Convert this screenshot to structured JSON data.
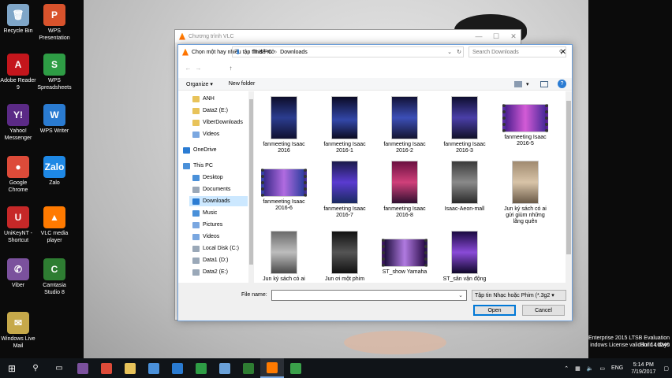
{
  "desktop": {
    "icons": [
      {
        "label": "Recycle Bin",
        "color": "#7fa6c8",
        "glyph": "🗑"
      },
      {
        "label": "WPS Presentation",
        "color": "#d9532c",
        "glyph": "P"
      },
      {
        "label": "Adobe Reader 9",
        "color": "#c4161c",
        "glyph": "A"
      },
      {
        "label": "WPS Spreadsheets",
        "color": "#2e9d45",
        "glyph": "S"
      },
      {
        "label": "Yahoo! Messenger",
        "color": "#5b2a86",
        "glyph": "Y!"
      },
      {
        "label": "WPS Writer",
        "color": "#2a7bd1",
        "glyph": "W"
      },
      {
        "label": "Google Chrome",
        "color": "#dd4b39",
        "glyph": "●"
      },
      {
        "label": "Zalo",
        "color": "#1e88e5",
        "glyph": "Zalo"
      },
      {
        "label": "UniKeyNT - Shortcut",
        "color": "#c62828",
        "glyph": "U"
      },
      {
        "label": "VLC media player",
        "color": "#ff7a00",
        "glyph": "▲"
      },
      {
        "label": "Viber",
        "color": "#7b519d",
        "glyph": "✆"
      },
      {
        "label": "Camtasia Studio 8",
        "color": "#2e7d32",
        "glyph": "C"
      },
      {
        "label": "Windows Live Mail",
        "color": "#c6a94a",
        "glyph": "✉"
      }
    ],
    "watermark_line1": "Enterprise 2015 LTSB Evaluation",
    "watermark_line2": "indows License valid for 14 days",
    "watermark_line3": "Build 10240"
  },
  "vlc_window": {
    "title": "Chương trình VLC"
  },
  "dialog": {
    "title": "Chọn một hay nhiều tập tin để mở",
    "close_glyph": "✕",
    "nav": {
      "back": "←",
      "forward": "→",
      "up": "↑"
    },
    "address": [
      "This PC",
      "Downloads"
    ],
    "search_placeholder": "Search Downloads",
    "organize_label": "Organize ▾",
    "new_folder_label": "New folder",
    "nav_items": [
      {
        "label": "ANH",
        "icon": "folder-icon",
        "color": "#e8c35a"
      },
      {
        "label": "Data2 (E:)",
        "icon": "folder-icon",
        "color": "#e8c35a"
      },
      {
        "label": "ViberDownloads",
        "icon": "folder-icon",
        "color": "#e8c35a"
      },
      {
        "label": "Videos",
        "icon": "video-icon",
        "color": "#7aa7e0"
      },
      {
        "label": "OneDrive",
        "icon": "cloud-icon",
        "color": "#2b7cd3"
      },
      {
        "label": "This PC",
        "icon": "computer-icon",
        "color": "#4a90d9"
      },
      {
        "label": "Desktop",
        "icon": "desktop-icon",
        "color": "#4a90d9"
      },
      {
        "label": "Documents",
        "icon": "documents-icon",
        "color": "#9aa8b8"
      },
      {
        "label": "Downloads",
        "icon": "download-icon",
        "color": "#2b7cd3"
      },
      {
        "label": "Music",
        "icon": "music-icon",
        "color": "#4a90d9"
      },
      {
        "label": "Pictures",
        "icon": "pictures-icon",
        "color": "#7aa7e0"
      },
      {
        "label": "Videos",
        "icon": "video-icon",
        "color": "#7aa7e0"
      },
      {
        "label": "Local Disk (C:)",
        "icon": "drive-icon",
        "color": "#9aa8b8"
      },
      {
        "label": "Data1 (D:)",
        "icon": "drive-icon",
        "color": "#9aa8b8"
      },
      {
        "label": "Data2 (E:)",
        "icon": "drive-icon",
        "color": "#9aa8b8"
      }
    ],
    "files": [
      {
        "line1": "fanmeeting Isaac",
        "line2": "2016",
        "thumb": "linear-gradient(#0d0d2a,#2b3d8f 50%,#101030)",
        "wide": false
      },
      {
        "line1": "fanmeeting Isaac",
        "line2": "2016-1",
        "thumb": "linear-gradient(#0b0b25,#3347a8 55%,#0c0c22)",
        "wide": false
      },
      {
        "line1": "fanmeeting Isaac",
        "line2": "2016-2",
        "thumb": "linear-gradient(#121236,#3c4fb7 50%,#141430)",
        "wide": false
      },
      {
        "line1": "fanmeeting Isaac",
        "line2": "2016-3",
        "thumb": "linear-gradient(#0e0e2e,#4a3fa8 50%,#111128)",
        "wide": false
      },
      {
        "line1": "fanmeeting Isaac",
        "line2": "2016-5",
        "thumb": "linear-gradient(90deg,#4d1f8f,#d35bd6 50%,#4b2a9a)",
        "wide": true
      },
      {
        "line1": "fanmeeting Isaac",
        "line2": "2016-6",
        "thumb": "linear-gradient(90deg,#3a2a8a,#b06be0 50%,#2f3fa0)",
        "wide": true
      },
      {
        "line1": "fanmeeting Isaac",
        "line2": "2016-7",
        "thumb": "linear-gradient(#1a1a4a,#5a3bd0 50%,#1a2a60)",
        "wide": false
      },
      {
        "line1": "fanmeeting Isaac",
        "line2": "2016-8",
        "thumb": "linear-gradient(#6a1040,#d0407a 50%,#301030)",
        "wide": false
      },
      {
        "line1": "Isaac-Aeon-mall",
        "line2": "",
        "thumb": "linear-gradient(#3a3a3a,#8a8a8a 50%,#2a2a2a)",
        "wide": false
      },
      {
        "line1": "Jun ký sách có ai",
        "line2": "gửi giùm những",
        "line3": "lãng quên",
        "thumb": "linear-gradient(#a08a70,#d8c4a8 50%,#6a5a48)",
        "wide": false
      },
      {
        "line1": "Jun ký sách có ai",
        "line2": "",
        "thumb": "linear-gradient(#6a6a6a,#bdbdbd 50%,#4a4a4a)",
        "wide": false
      },
      {
        "line1": "Jun ơi một phim",
        "line2": "",
        "thumb": "linear-gradient(#111,#555 50%,#111)",
        "wide": false
      },
      {
        "line1": "ST_show Yamaha",
        "line2": "",
        "thumb": "linear-gradient(90deg,#201040,#b07ae0 50%,#301050)",
        "wide": true
      },
      {
        "line1": "ST_sân vận động",
        "line2": "",
        "thumb": "linear-gradient(#1a0a40,#8a4ad8 50%,#10082a)",
        "wide": false
      }
    ],
    "file_name_label": "File name:",
    "file_name_value": "",
    "filter_value": "Tập tin Nhạc hoặc Phim (*.3g2 ▾",
    "open_label": "Open",
    "cancel_label": "Cancel"
  },
  "taskbar": {
    "start_glyph": "⊞",
    "search_glyph": "⚲",
    "taskview_glyph": "▭",
    "apps": [
      {
        "name": "viber",
        "color": "#7b519d",
        "active": false
      },
      {
        "name": "chrome",
        "color": "#dd4b39",
        "active": false
      },
      {
        "name": "folder",
        "color": "#e8c35a",
        "active": false
      },
      {
        "name": "explorer",
        "color": "#4a90d9",
        "active": false
      },
      {
        "name": "wps-writer",
        "color": "#2a7bd1",
        "active": false
      },
      {
        "name": "wps-spreadsheets",
        "color": "#2e9d45",
        "active": false
      },
      {
        "name": "app-misc",
        "color": "#6aa1d8",
        "active": false
      },
      {
        "name": "camtasia",
        "color": "#2e7d32",
        "active": false
      },
      {
        "name": "vlc",
        "color": "#ff7a00",
        "active": true
      },
      {
        "name": "camtasia-recorder",
        "color": "#3aa04a",
        "active": false
      }
    ],
    "lang": "ENG",
    "time": "5:14 PM",
    "date": "7/19/2017"
  }
}
